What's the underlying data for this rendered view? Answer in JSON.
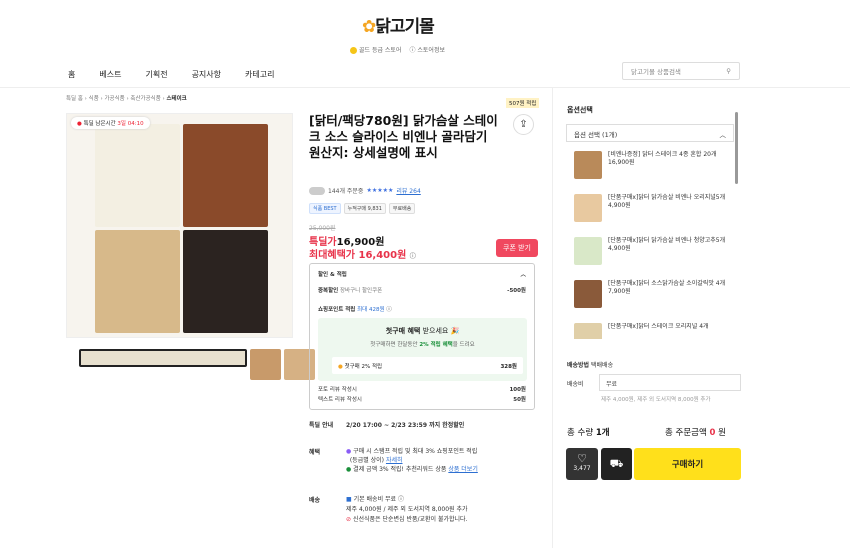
{
  "brand": {
    "logo": "닭고기몰",
    "grade": "골드 등급 스토어",
    "store_info": "스토어정보"
  },
  "nav": [
    "홈",
    "베스트",
    "기획전",
    "공지사항",
    "카테고리"
  ],
  "search": {
    "placeholder": "닭고기몰 상품검색"
  },
  "breadcrumb": [
    "특딜 홈",
    "식품",
    "가공식품",
    "축산가공식품",
    "스테이크"
  ],
  "timer": {
    "label": "특딜 남은시간",
    "value": "3일 04:10"
  },
  "points_badge": "507원 적립",
  "product": {
    "title": "[닭터/팩당780원] 닭가슴살 스테이크 소스 슬라이스 비엔나 골라담기",
    "origin": "원산지: 상세설명에 표시",
    "reviews_count": "144개 주문중",
    "stars": "★★★★★",
    "review_link": "리뷰 264",
    "tags": [
      "식품 BEST",
      "누적구매 9,831",
      "무료배송"
    ],
    "old_price": "25,000원",
    "deal_label": "특딜가",
    "deal_price": "16,900원",
    "max_label": "최대혜택가",
    "max_price": "16,400원",
    "coupon": "쿠폰 받기"
  },
  "discount_box": {
    "title": "할인 & 적립",
    "dup_label": "중복할인",
    "dup_desc": "장바구니 할인쿠폰",
    "dup_value": "-500원",
    "point_label": "쇼핑포인트 적립",
    "point_max": "최대 428원",
    "first_title": "첫구매 혜택",
    "first_suffix": "받으세요",
    "first_desc_a": "첫구매하면 한달동안",
    "first_desc_b": "2% 적립 혜택",
    "first_desc_c": "을 드려요",
    "first_item": "첫구매 2% 적립",
    "first_value": "328원",
    "photo_label": "포토 리뷰 작성시",
    "photo_value": "100원",
    "text_label": "텍스트 리뷰 작성시",
    "text_value": "50원"
  },
  "info": {
    "deal_label": "특딜 안내",
    "deal_value": "2/20 17:00 ~ 2/23 23:59 까지 한정할인",
    "benefit_label": "혜택",
    "benefit1": "구매 시 스탬프 적립 및 최대 3% 쇼핑포인트 적립",
    "benefit1b": "(등급별 상이)",
    "benefit1_link": "자세히",
    "benefit2": "결제 금액 3% 적립! 추천리워드 상품",
    "benefit2_link": "상품 더보기",
    "ship_label": "배송",
    "ship1": "기본 배송비 무료",
    "ship2": "제주 4,000원 / 제주 외 도서지역 8,000원 추가",
    "ship3": "신선식품은 단순변심 반품/교환이 불가합니다."
  },
  "options": {
    "title": "옵션선택",
    "select": "옵션 선택 (1개)",
    "items": [
      {
        "name": "[비엔나증정] 닭터 스테이크 4종 혼합 20개",
        "price": "16,900원"
      },
      {
        "name": "[단품구매x]닭터 닭가슴살 비엔나 오리지널5개",
        "price": "4,900원"
      },
      {
        "name": "[단품구매x]닭터 닭가슴살 비엔나 청양고추5개",
        "price": "4,900원"
      },
      {
        "name": "[단품구매x]닭터 소스닭가슴살 소이갈릭맛 4개",
        "price": "7,900원"
      },
      {
        "name": "[단품구매x]닭터 스테이크 오리지널 4개",
        "price": ""
      }
    ]
  },
  "delivery": {
    "method_label": "배송방법",
    "method": "택배배송",
    "fee_label": "배송비",
    "fee": "무료",
    "extra": "제주 4,000원, 제주 외 도서지역 8,000원 추가"
  },
  "summary": {
    "qty_label": "총 수량",
    "qty": "1개",
    "total_label": "총 주문금액",
    "total": "0",
    "unit": "원"
  },
  "actions": {
    "like_count": "3,477",
    "buy": "구매하기"
  }
}
